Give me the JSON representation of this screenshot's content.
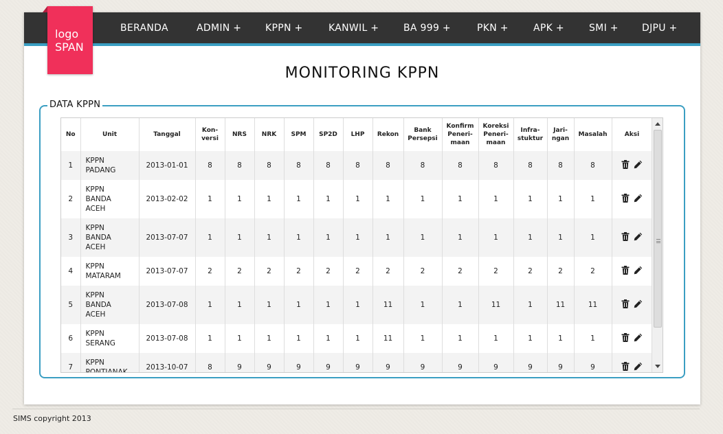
{
  "logo": {
    "line1": "logo",
    "line2": "SPAN"
  },
  "nav": [
    {
      "label": "BERANDA"
    },
    {
      "label": "ADMIN +"
    },
    {
      "label": "KPPN +"
    },
    {
      "label": "KANWIL +"
    },
    {
      "label": "BA 999 +"
    },
    {
      "label": "PKN +"
    },
    {
      "label": "APK +"
    },
    {
      "label": "SMI +"
    },
    {
      "label": "DJPU +"
    }
  ],
  "page_title": "MONITORING KPPN",
  "section_title": "DATA KPPN",
  "columns": [
    "No",
    "Unit",
    "Tanggal",
    "Kon-\nversi",
    "NRS",
    "NRK",
    "SPM",
    "SP2D",
    "LHP",
    "Rekon",
    "Bank\nPersepsi",
    "Konfirm\nPeneri-\nmaan",
    "Koreksi\nPeneri-\nmaan",
    "Infra-\nstuktur",
    "Jari-\nngan",
    "Masalah",
    "Aksi"
  ],
  "rows": [
    {
      "no": "1",
      "unit": "KPPN\nPADANG",
      "tanggal": "2013-01-01",
      "vals": [
        "8",
        "8",
        "8",
        "8",
        "8",
        "8",
        "8",
        "8",
        "8",
        "8",
        "8",
        "8",
        "8"
      ]
    },
    {
      "no": "2",
      "unit": "KPPN\nBANDA\nACEH",
      "tanggal": "2013-02-02",
      "vals": [
        "1",
        "1",
        "1",
        "1",
        "1",
        "1",
        "1",
        "1",
        "1",
        "1",
        "1",
        "1",
        "1"
      ]
    },
    {
      "no": "3",
      "unit": "KPPN\nBANDA\nACEH",
      "tanggal": "2013-07-07",
      "vals": [
        "1",
        "1",
        "1",
        "1",
        "1",
        "1",
        "1",
        "1",
        "1",
        "1",
        "1",
        "1",
        "1"
      ]
    },
    {
      "no": "4",
      "unit": "KPPN\nMATARAM",
      "tanggal": "2013-07-07",
      "vals": [
        "2",
        "2",
        "2",
        "2",
        "2",
        "2",
        "2",
        "2",
        "2",
        "2",
        "2",
        "2",
        "2"
      ]
    },
    {
      "no": "5",
      "unit": "KPPN\nBANDA\nACEH",
      "tanggal": "2013-07-08",
      "vals": [
        "1",
        "1",
        "1",
        "1",
        "1",
        "1",
        "11",
        "1",
        "1",
        "11",
        "1",
        "11",
        "11"
      ]
    },
    {
      "no": "6",
      "unit": "KPPN\nSERANG",
      "tanggal": "2013-07-08",
      "vals": [
        "1",
        "1",
        "1",
        "1",
        "1",
        "1",
        "11",
        "1",
        "1",
        "1",
        "1",
        "1",
        "1"
      ]
    },
    {
      "no": "7",
      "unit": "KPPN\nPONTIANAK",
      "tanggal": "2013-10-07",
      "vals": [
        "8",
        "9",
        "9",
        "9",
        "9",
        "9",
        "9",
        "9",
        "9",
        "9",
        "9",
        "9",
        "9"
      ]
    }
  ],
  "icons": {
    "delete": "trash-icon",
    "edit": "pencil-icon"
  },
  "footer": "SIMS copyright 2013"
}
